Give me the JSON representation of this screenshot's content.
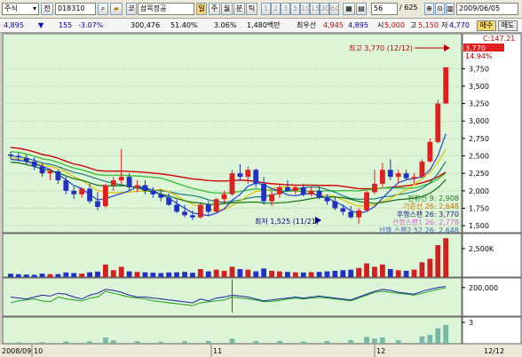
{
  "toolbar": {
    "market_label": "주식",
    "market_dd": "▾",
    "prefix_label": "전",
    "code_value": "018310",
    "search_glyph": "⌕",
    "name_prefix": "코",
    "stock_name": "삼목정공",
    "period_btns": [
      "주",
      "월",
      "분",
      "틱"
    ],
    "minute_btns": [
      "1",
      "2",
      "3",
      "5",
      "10",
      "15",
      "30",
      "60"
    ],
    "count_value": "56",
    "count_total": "/ 625",
    "date_value": "2009/06/05"
  },
  "quote": {
    "price": "4,895",
    "change_arrow": "▼",
    "change": "155",
    "change_pct": "-3.07%",
    "volume": "300,476",
    "ratio1": "51.40%",
    "ratio2": "3.06%",
    "amount": "1,480백만",
    "best_bid_label": "최우선",
    "best_ask": "4,945",
    "best_bid": "4,895",
    "open_label": "시",
    "open": "5,000",
    "high_label": "고",
    "high": "5,150",
    "low_label": "저",
    "low": "4,770",
    "buy_label": "매수",
    "sell_label": "매도"
  },
  "chart": {
    "annot_high": "최고 3,770 (12/12)",
    "annot_low": "최저 1,525 (11/21)",
    "c_label": "C:147.21",
    "price_badge": "3,770",
    "pct_badge": "14.94%",
    "legend": [
      {
        "text": "전환선 9: 2,908",
        "color": "#1a7a1a"
      },
      {
        "text": "기준선 26: 2,648",
        "color": "#d07000"
      },
      {
        "text": "후행스팬 26: 3,770",
        "color": "#1a1a80"
      },
      {
        "text": "선행스팬1 26: 2,778",
        "color": "#e060e0"
      },
      {
        "text": "선행 스팬2 52,26: 2,648",
        "color": "#4060c0"
      }
    ],
    "vol_label": "2,500K",
    "ind_label": "200,000",
    "ind2_label": "3",
    "date_labels": [
      "2008/09",
      "10",
      "11",
      "12",
      "12/12"
    ]
  },
  "chart_data": {
    "type": "candlestick",
    "price_axis": [
      "3,750",
      "3,500",
      "3,250",
      "3,000",
      "2,750",
      "2,500",
      "2,250",
      "2,000",
      "1,750",
      "1,500"
    ],
    "ylim": [
      1400,
      4250
    ],
    "candles": [
      {
        "o": 2520,
        "h": 2560,
        "l": 2460,
        "c": 2500
      },
      {
        "o": 2500,
        "h": 2540,
        "l": 2420,
        "c": 2480
      },
      {
        "o": 2470,
        "h": 2520,
        "l": 2380,
        "c": 2420
      },
      {
        "o": 2420,
        "h": 2480,
        "l": 2300,
        "c": 2350
      },
      {
        "o": 2350,
        "h": 2400,
        "l": 2200,
        "c": 2250
      },
      {
        "o": 2250,
        "h": 2320,
        "l": 2150,
        "c": 2280
      },
      {
        "o": 2280,
        "h": 2300,
        "l": 2100,
        "c": 2150
      },
      {
        "o": 2150,
        "h": 2200,
        "l": 1950,
        "c": 2000
      },
      {
        "o": 2000,
        "h": 2060,
        "l": 1880,
        "c": 1950
      },
      {
        "o": 1950,
        "h": 2050,
        "l": 1900,
        "c": 2030
      },
      {
        "o": 2030,
        "h": 2100,
        "l": 1820,
        "c": 1850
      },
      {
        "o": 1850,
        "h": 1980,
        "l": 1720,
        "c": 1770
      },
      {
        "o": 1780,
        "h": 2100,
        "l": 1760,
        "c": 2080
      },
      {
        "o": 2080,
        "h": 2200,
        "l": 2000,
        "c": 2150
      },
      {
        "o": 2150,
        "h": 2600,
        "l": 2100,
        "c": 2200
      },
      {
        "o": 2200,
        "h": 2250,
        "l": 2000,
        "c": 2050
      },
      {
        "o": 2050,
        "h": 2150,
        "l": 1980,
        "c": 2080
      },
      {
        "o": 2080,
        "h": 2150,
        "l": 1950,
        "c": 2000
      },
      {
        "o": 2000,
        "h": 2050,
        "l": 1900,
        "c": 1950
      },
      {
        "o": 1950,
        "h": 2020,
        "l": 1850,
        "c": 1900
      },
      {
        "o": 1900,
        "h": 1970,
        "l": 1780,
        "c": 1800
      },
      {
        "o": 1800,
        "h": 1880,
        "l": 1680,
        "c": 1700
      },
      {
        "o": 1700,
        "h": 1800,
        "l": 1620,
        "c": 1650
      },
      {
        "o": 1650,
        "h": 1720,
        "l": 1580,
        "c": 1620
      },
      {
        "o": 1620,
        "h": 1820,
        "l": 1600,
        "c": 1800
      },
      {
        "o": 1800,
        "h": 1850,
        "l": 1650,
        "c": 1700
      },
      {
        "o": 1700,
        "h": 1900,
        "l": 1680,
        "c": 1880
      },
      {
        "o": 1880,
        "h": 2000,
        "l": 1820,
        "c": 1950
      },
      {
        "o": 1950,
        "h": 2300,
        "l": 1930,
        "c": 2250
      },
      {
        "o": 2250,
        "h": 2380,
        "l": 2150,
        "c": 2200
      },
      {
        "o": 2200,
        "h": 2350,
        "l": 2100,
        "c": 2300
      },
      {
        "o": 2300,
        "h": 2320,
        "l": 2050,
        "c": 2100
      },
      {
        "o": 2100,
        "h": 2200,
        "l": 1800,
        "c": 1850
      },
      {
        "o": 1850,
        "h": 2000,
        "l": 1780,
        "c": 1950
      },
      {
        "o": 1950,
        "h": 2100,
        "l": 1900,
        "c": 2050
      },
      {
        "o": 2050,
        "h": 2150,
        "l": 1980,
        "c": 2000
      },
      {
        "o": 2000,
        "h": 2080,
        "l": 1950,
        "c": 2050
      },
      {
        "o": 2050,
        "h": 2100,
        "l": 1920,
        "c": 1950
      },
      {
        "o": 1950,
        "h": 2050,
        "l": 1920,
        "c": 2000
      },
      {
        "o": 2000,
        "h": 2060,
        "l": 1880,
        "c": 1900
      },
      {
        "o": 1900,
        "h": 1950,
        "l": 1800,
        "c": 1850
      },
      {
        "o": 1850,
        "h": 1900,
        "l": 1720,
        "c": 1750
      },
      {
        "o": 1750,
        "h": 1800,
        "l": 1650,
        "c": 1700
      },
      {
        "o": 1700,
        "h": 1780,
        "l": 1600,
        "c": 1620
      },
      {
        "o": 1620,
        "h": 1750,
        "l": 1525,
        "c": 1720
      },
      {
        "o": 1720,
        "h": 2000,
        "l": 1700,
        "c": 1980
      },
      {
        "o": 1980,
        "h": 2300,
        "l": 1950,
        "c": 2100
      },
      {
        "o": 2100,
        "h": 2400,
        "l": 2050,
        "c": 2300
      },
      {
        "o": 2300,
        "h": 2450,
        "l": 2150,
        "c": 2200
      },
      {
        "o": 2200,
        "h": 2300,
        "l": 2100,
        "c": 2250
      },
      {
        "o": 2250,
        "h": 2300,
        "l": 2150,
        "c": 2180
      },
      {
        "o": 2180,
        "h": 2250,
        "l": 2100,
        "c": 2200
      },
      {
        "o": 2200,
        "h": 2450,
        "l": 2180,
        "c": 2420
      },
      {
        "o": 2420,
        "h": 2750,
        "l": 2400,
        "c": 2700
      },
      {
        "o": 2700,
        "h": 3300,
        "l": 2680,
        "c": 3250
      },
      {
        "o": 3250,
        "h": 3770,
        "l": 3250,
        "c": 3770
      }
    ],
    "volume_k": [
      300,
      250,
      220,
      200,
      300,
      250,
      260,
      400,
      350,
      300,
      420,
      480,
      1100,
      600,
      900,
      500,
      450,
      420,
      380,
      350,
      400,
      420,
      450,
      380,
      700,
      500,
      650,
      550,
      900,
      700,
      650,
      500,
      750,
      550,
      500,
      450,
      420,
      400,
      430,
      450,
      500,
      550,
      600,
      650,
      800,
      1200,
      900,
      1100,
      700,
      600,
      550,
      650,
      1300,
      1600,
      2800,
      3400
    ],
    "vol_max_k": 3500,
    "indicator": [
      150,
      145,
      140,
      150,
      160,
      155,
      170,
      165,
      150,
      140,
      160,
      170,
      190,
      185,
      175,
      160,
      150,
      150,
      145,
      140,
      135,
      130,
      125,
      120,
      140,
      130,
      145,
      150,
      160,
      155,
      150,
      140,
      130,
      135,
      140,
      145,
      150,
      145,
      150,
      155,
      150,
      145,
      140,
      135,
      150,
      165,
      180,
      190,
      185,
      175,
      170,
      165,
      180,
      190,
      200,
      205
    ],
    "indicator2": [
      120,
      130,
      135,
      140,
      130,
      125,
      150,
      140,
      135,
      130,
      145,
      150,
      180,
      170,
      160,
      150,
      145,
      140,
      130,
      125,
      120,
      115,
      110,
      105,
      120,
      125,
      130,
      135,
      150,
      145,
      140,
      135,
      125,
      128,
      132,
      140,
      145,
      140,
      145,
      148,
      145,
      140,
      135,
      130,
      145,
      160,
      175,
      180,
      175,
      170,
      165,
      160,
      170,
      180,
      190,
      198
    ],
    "indicator_range": [
      50,
      250
    ]
  }
}
